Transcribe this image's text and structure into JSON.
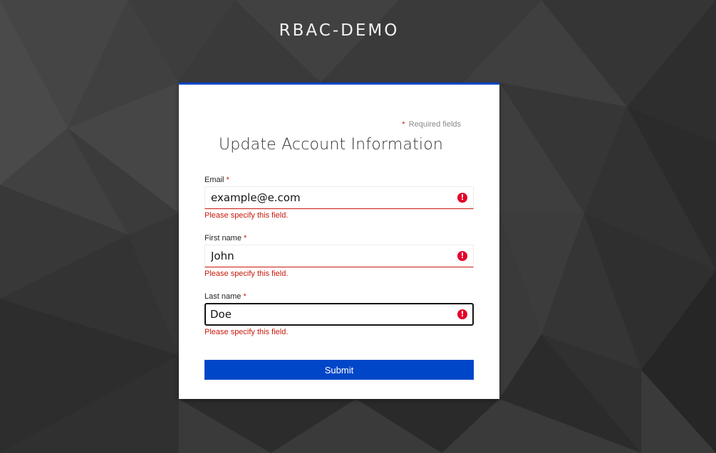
{
  "brand": {
    "title": "RBAC-DEMO"
  },
  "form": {
    "required_star": "*",
    "required_text": "Required fields",
    "title": "Update Account Information",
    "fields": [
      {
        "label": "Email",
        "required_mark": "*",
        "value": "example@e.com",
        "error": "Please specify this field.",
        "error_icon": "!"
      },
      {
        "label": "First name",
        "required_mark": "*",
        "value": "John",
        "error": "Please specify this field.",
        "error_icon": "!"
      },
      {
        "label": "Last name",
        "required_mark": "*",
        "value": "Doe",
        "error": "Please specify this field.",
        "error_icon": "!"
      }
    ],
    "submit_label": "Submit"
  },
  "colors": {
    "accent": "#0046c8",
    "error": "#c9190b",
    "error_icon": "#e4002b"
  }
}
